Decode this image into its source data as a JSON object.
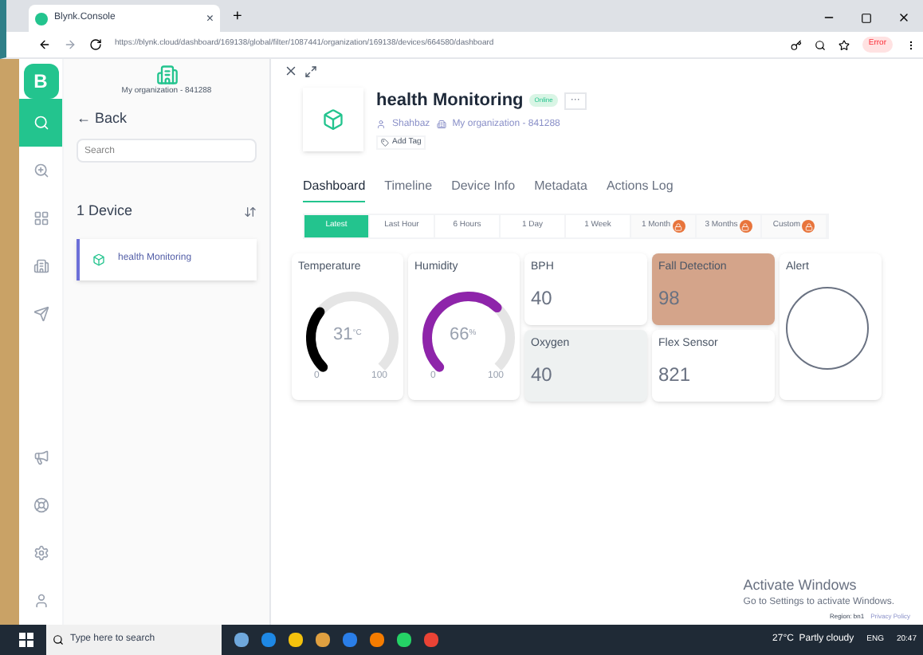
{
  "browser": {
    "tab": {
      "title": "Blynk.Console",
      "close": "×"
    },
    "new_tab": "+",
    "url": "https://blynk.cloud/dashboard/169138/global/filter/1087441/organization/169138/devices/664580/dashboard",
    "profile_badge": "Error"
  },
  "app": {
    "logo": "B",
    "nav": [
      {
        "selected": true
      },
      {
        "selected": false
      },
      {
        "selected": false
      },
      {
        "selected": false
      },
      {
        "selected": false
      },
      {
        "selected": false
      },
      {
        "selected": false
      },
      {
        "selected": false
      },
      {
        "selected": false
      }
    ],
    "sidebar": {
      "organization": "My organization - 841288",
      "back": "← Back",
      "search": {
        "placeholder": "Search"
      },
      "count": "1 Device",
      "devices": [
        {
          "name": "health Monitoring",
          "selected": true
        }
      ]
    },
    "device": {
      "name": "health Monitoring",
      "status": "Online",
      "online": true,
      "more": "···",
      "owner": "Shahbaz",
      "organization": "My organization - 841288",
      "add_tag": "Add Tag"
    },
    "tabs": [
      {
        "label": "Dashboard",
        "selected": true
      },
      {
        "label": "Timeline",
        "selected": false
      },
      {
        "label": "Device Info",
        "selected": false
      },
      {
        "label": "Metadata",
        "selected": false
      },
      {
        "label": "Actions Log",
        "selected": false
      }
    ],
    "ranges": [
      {
        "label": "Latest",
        "selected": true,
        "locked": false
      },
      {
        "label": "Last Hour",
        "selected": false,
        "locked": false
      },
      {
        "label": "6 Hours",
        "selected": false,
        "locked": false
      },
      {
        "label": "1 Day",
        "selected": false,
        "locked": false
      },
      {
        "label": "1 Week",
        "selected": false,
        "locked": false
      },
      {
        "label": "1 Month",
        "selected": false,
        "locked": true
      },
      {
        "label": "3 Months",
        "selected": false,
        "locked": true
      },
      {
        "label": "Custom",
        "selected": false,
        "locked": true
      }
    ],
    "widgets": [
      {
        "kind": "gauge",
        "title": "Temperature",
        "value": "31",
        "unit": "°C",
        "min": "0",
        "max": "100",
        "color": "#000000"
      },
      {
        "kind": "gauge",
        "title": "Humidity",
        "value": "66",
        "unit": "%",
        "min": "0",
        "max": "100",
        "color": "#8e24aa"
      },
      {
        "kind": "stack",
        "items": [
          {
            "title": "BPH",
            "value": "40",
            "color": "#ffffff"
          },
          {
            "title": "Oxygen",
            "value": "40",
            "color": "#eef1f1"
          }
        ]
      },
      {
        "kind": "stack",
        "items": [
          {
            "title": "Fall Detection",
            "value": "98",
            "color": "#d4a48a"
          },
          {
            "title": "Flex Sensor",
            "value": "821",
            "color": "#ffffff"
          }
        ]
      },
      {
        "kind": "led",
        "title": "Alert",
        "on": false
      }
    ],
    "activation": {
      "title": "Activate Windows",
      "text": "Go to Settings to activate Windows."
    },
    "footer": {
      "region": "Region: bn1",
      "link": "Privacy Policy"
    }
  },
  "taskbar": {
    "search": {
      "placeholder": "Type here to search"
    },
    "weather": "27°C  Partly cloudy",
    "language": "ENG",
    "time": "20:47"
  }
}
